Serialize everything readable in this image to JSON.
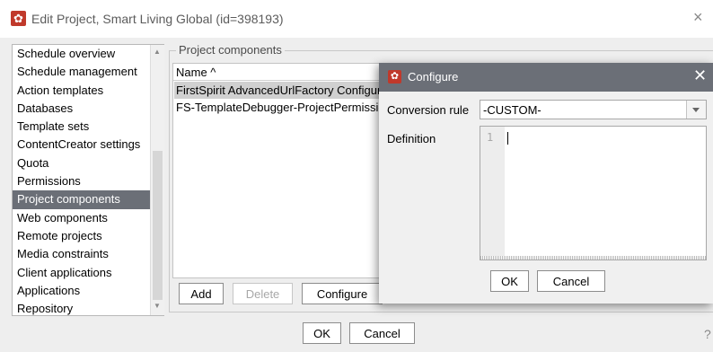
{
  "window": {
    "title": "Edit Project, Smart Living Global (id=398193)",
    "close_glyph": "×",
    "icon": "gear-icon"
  },
  "nav": {
    "items": [
      {
        "label": "Schedule overview"
      },
      {
        "label": "Schedule management"
      },
      {
        "label": "Action templates"
      },
      {
        "label": "Databases"
      },
      {
        "label": "Template sets"
      },
      {
        "label": "ContentCreator settings"
      },
      {
        "label": "Quota"
      },
      {
        "label": "Permissions"
      },
      {
        "label": "Project components",
        "selected": true
      },
      {
        "label": "Web components"
      },
      {
        "label": "Remote projects"
      },
      {
        "label": "Media constraints"
      },
      {
        "label": "Client applications"
      },
      {
        "label": "Applications"
      },
      {
        "label": "Repository"
      }
    ],
    "scroll_up": "▲",
    "scroll_down": "▼"
  },
  "components": {
    "group_label": "Project components",
    "column_header": "Name ^",
    "rows": [
      {
        "name": "FirstSpirit AdvancedUrlFactory Configuration",
        "selected": true
      },
      {
        "name": "FS-TemplateDebugger-ProjectPermissions"
      }
    ],
    "buttons": {
      "add": "Add",
      "delete": "Delete",
      "configure": "Configure"
    }
  },
  "footer": {
    "ok": "OK",
    "cancel": "Cancel",
    "help": "?"
  },
  "dialog": {
    "title": "Configure",
    "close_glyph": "✕",
    "icon": "gear-icon",
    "conversion_rule_label": "Conversion rule",
    "conversion_rule_value": "-CUSTOM-",
    "definition_label": "Definition",
    "definition_line_number": "1",
    "ok": "OK",
    "cancel": "Cancel"
  },
  "colors": {
    "selection": "#6b6f77",
    "title_bg": "#6b6f77",
    "brand_icon": "#c0392b"
  }
}
